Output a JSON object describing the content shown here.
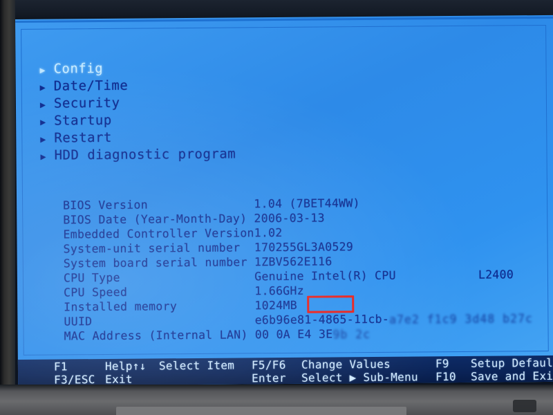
{
  "screen": {
    "type": "bios-setup-utility",
    "accent_highlight": "#c9ecff",
    "text_color": "#0d2a8f",
    "background_color": "#2d8ae8",
    "annotation_color": "#e8201c"
  },
  "menu": {
    "caret": "▶",
    "items": [
      {
        "label": "Config",
        "selected": true
      },
      {
        "label": "Date/Time",
        "selected": false
      },
      {
        "label": "Security",
        "selected": false
      },
      {
        "label": "Startup",
        "selected": false
      },
      {
        "label": "Restart",
        "selected": false
      },
      {
        "label": "HDD diagnostic program",
        "selected": false
      }
    ]
  },
  "info": {
    "rows": [
      {
        "label": "BIOS Version",
        "value": "1.04   (7BET44WW)",
        "value2": "",
        "blurred": ""
      },
      {
        "label": "BIOS Date (Year-Month-Day)",
        "value": "2006-03-13",
        "value2": "",
        "blurred": ""
      },
      {
        "label": "Embedded Controller Version",
        "value": "1.02",
        "value2": "",
        "blurred": ""
      },
      {
        "label": "System-unit serial number",
        "value": "170255GL3A0529",
        "value2": "",
        "blurred": ""
      },
      {
        "label": "System board serial number",
        "value": "1ZBV562E116",
        "value2": "",
        "blurred": ""
      },
      {
        "label": "CPU Type",
        "value": "Genuine Intel(R) CPU",
        "value2": "L2400",
        "blurred": ""
      },
      {
        "label": "CPU Speed",
        "value": "1.66GHz",
        "value2": "",
        "blurred": ""
      },
      {
        "label": "Installed memory",
        "value": "1024MB",
        "value2": "",
        "blurred": "",
        "highlighted": true
      },
      {
        "label": "UUID",
        "value": "e6b96e81-4865-11cb-",
        "value2": "",
        "blurred": "a7e2 f1c9 3d48 b27c"
      },
      {
        "label": "MAC Address (Internal LAN)",
        "value": "00 0A E4 3E",
        "value2": "",
        "blurred": "9b 2c"
      }
    ]
  },
  "footer": {
    "row1": {
      "key1": "F1",
      "action1": "Help↑↓",
      "action2": "Select Item",
      "key2": "F5/F6",
      "action3": "Change Values",
      "key3": "F9",
      "action4": "Setup Defaults"
    },
    "row2": {
      "key1": "F3/ESC",
      "action1": "Exit",
      "action2": "",
      "key2": "Enter",
      "action3": "Select ▶ Sub-Menu",
      "key3": "F10",
      "action4": "Save and Exit"
    }
  }
}
